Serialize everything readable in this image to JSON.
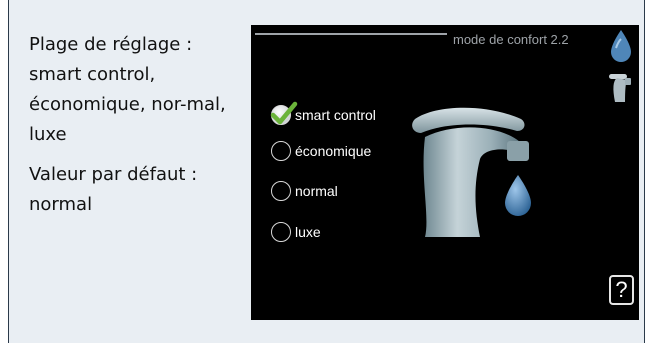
{
  "description": {
    "range_label": "Plage de réglage :",
    "range_values": "smart control, économique, nor-mal, luxe",
    "default_label": "Valeur par défaut :",
    "default_value": "normal"
  },
  "screen": {
    "title": "mode de confort 2.2",
    "options": [
      {
        "label": "smart control",
        "checked": true
      },
      {
        "label": "économique",
        "checked": false
      },
      {
        "label": "normal",
        "checked": false
      },
      {
        "label": "luxe",
        "checked": false
      }
    ],
    "help_button": "?"
  },
  "icons": {
    "water_drop": "water-drop-icon",
    "tap": "tap-icon",
    "checkmark": "checkmark-icon"
  },
  "colors": {
    "screen_bg": "#000000",
    "title_text": "#9ea3a8",
    "checkmark": "#6bb33a",
    "drop": "#4f86b8"
  }
}
